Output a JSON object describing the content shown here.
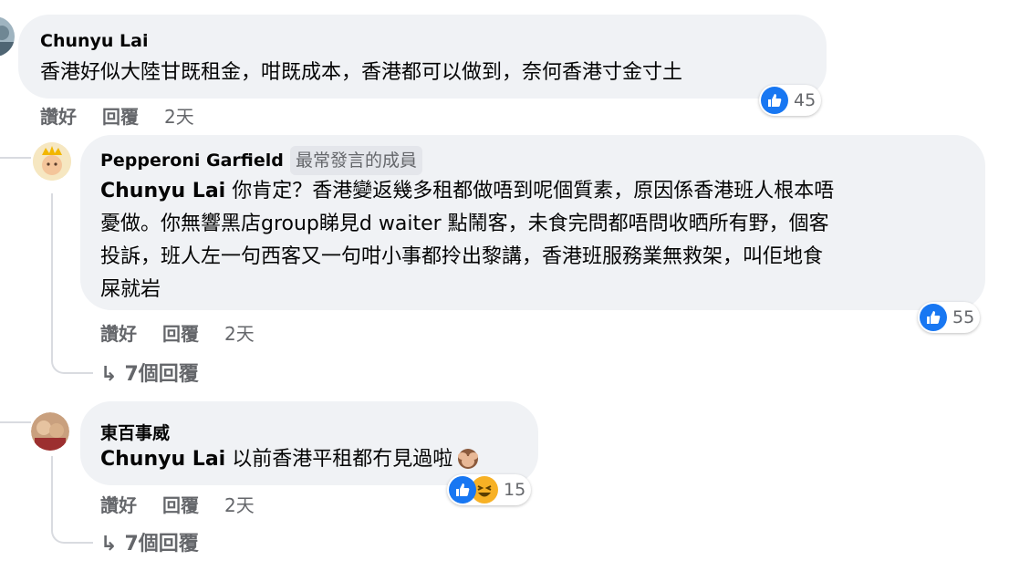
{
  "colors": {
    "like_blue": "#1877f2",
    "bubble_bg": "#f0f2f5",
    "meta_grey": "#65676b",
    "haha_yellow": "#f7b125"
  },
  "comments": [
    {
      "author": "Chunyu Lai",
      "text": "香港好似大陸甘既租金，咁既成本，香港都可以做到，奈何香港寸金寸土",
      "actions": {
        "like": "讚好",
        "reply": "回覆",
        "time": "2天"
      },
      "reactions": {
        "icons": [
          "like-icon"
        ],
        "count": "45"
      }
    },
    {
      "author": "Pepperoni Garfield",
      "badge": "最常發言的成員",
      "mention": "Chunyu Lai",
      "text_lines": [
        " 你肯定？香港變返幾多租都做唔到呢個質素，原因係香港班人根本唔",
        "憂做。你無響黑店group睇見d waiter 點鬧客，未食完問都唔問收晒所有野，個客",
        "投訴，班人左一句西客又一句咁小事都拎出黎講，香港班服務業無救架，叫佢地食",
        "屎就岩"
      ],
      "actions": {
        "like": "讚好",
        "reply": "回覆",
        "time": "2天"
      },
      "reactions": {
        "icons": [
          "like-icon"
        ],
        "count": "55"
      },
      "replies_link": "7個回覆"
    },
    {
      "author": "東百事威",
      "mention": "Chunyu Lai",
      "text": " 以前香港平租都冇見過啦",
      "emoji": "see-no-evil-monkey-emoji",
      "actions": {
        "like": "讚好",
        "reply": "回覆",
        "time": "2天"
      },
      "reactions": {
        "icons": [
          "like-icon",
          "haha-icon"
        ],
        "count": "15"
      },
      "replies_link": "7個回覆"
    }
  ]
}
